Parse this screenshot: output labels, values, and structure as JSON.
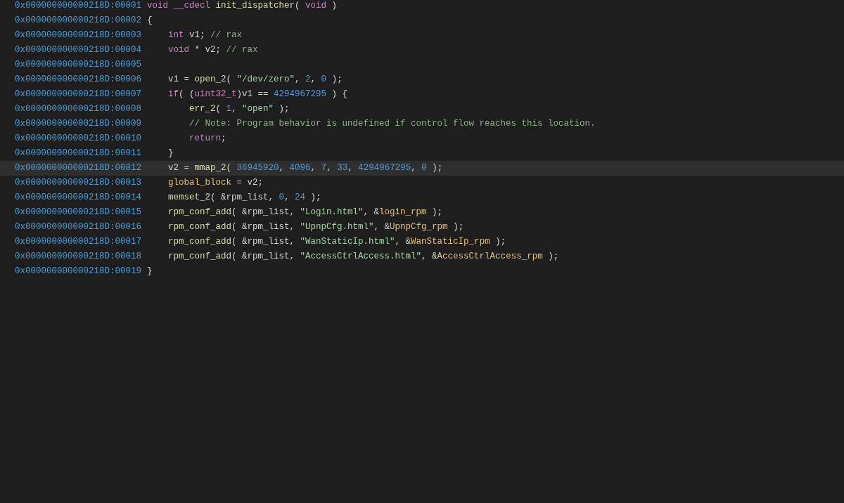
{
  "lines": [
    {
      "address": "0x000000000000218D:00001",
      "selected": false,
      "code": [
        {
          "kind": "kw",
          "text": "void"
        },
        {
          "kind": "kw",
          "text": " __cdecl"
        },
        {
          "kind": "fn",
          "text": " init_dispatcher"
        },
        {
          "kind": "tx",
          "text": "( "
        },
        {
          "kind": "kw",
          "text": "void"
        },
        {
          "kind": "tx",
          "text": " )"
        }
      ]
    },
    {
      "address": "0x000000000000218D:00002",
      "selected": false,
      "code": [
        {
          "kind": "tx",
          "text": "{"
        }
      ]
    },
    {
      "address": "0x000000000000218D:00003",
      "selected": false,
      "code": [
        {
          "kind": "kw",
          "text": "    int"
        },
        {
          "kind": "tx",
          "text": " v1; "
        },
        {
          "kind": "cm",
          "text": "// rax"
        }
      ]
    },
    {
      "address": "0x000000000000218D:00004",
      "selected": false,
      "code": [
        {
          "kind": "kw",
          "text": "    void"
        },
        {
          "kind": "tx",
          "text": " * v2; "
        },
        {
          "kind": "cm",
          "text": "// rax"
        }
      ]
    },
    {
      "address": "0x000000000000218D:00005",
      "selected": false
    },
    {
      "address": "0x000000000000218D:00006",
      "selected": false,
      "code": [
        {
          "kind": "tx",
          "text": "    v1 = "
        },
        {
          "kind": "fn",
          "text": "open_2"
        },
        {
          "kind": "tx",
          "text": "( "
        },
        {
          "kind": "str",
          "text": "\"/dev/zero\""
        },
        {
          "kind": "tx",
          "text": ", "
        },
        {
          "kind": "num",
          "text": "2"
        },
        {
          "kind": "tx",
          "text": ", "
        },
        {
          "kind": "num",
          "text": "0"
        },
        {
          "kind": "tx",
          "text": " );"
        }
      ]
    },
    {
      "address": "0x000000000000218D:00007",
      "selected": false,
      "code": [
        {
          "kind": "kw",
          "text": "    if"
        },
        {
          "kind": "tx",
          "text": "( ("
        },
        {
          "kind": "kw",
          "text": "uint32_t"
        },
        {
          "kind": "tx",
          "text": ")v1 == "
        },
        {
          "kind": "num",
          "text": "4294967295"
        },
        {
          "kind": "tx",
          "text": " ) {"
        }
      ]
    },
    {
      "address": "0x000000000000218D:00008",
      "selected": false,
      "code": [
        {
          "kind": "fn",
          "text": "        err_2"
        },
        {
          "kind": "tx",
          "text": "( "
        },
        {
          "kind": "num",
          "text": "1"
        },
        {
          "kind": "tx",
          "text": ", "
        },
        {
          "kind": "str",
          "text": "\"open\""
        },
        {
          "kind": "tx",
          "text": " );"
        }
      ]
    },
    {
      "address": "0x000000000000218D:00009",
      "selected": false,
      "code": [
        {
          "kind": "cm",
          "text": "        // Note: Program behavior is undefined if control flow reaches this location."
        }
      ]
    },
    {
      "address": "0x000000000000218D:00010",
      "selected": false,
      "code": [
        {
          "kind": "kw",
          "text": "        return"
        },
        {
          "kind": "tx",
          "text": ";"
        }
      ]
    },
    {
      "address": "0x000000000000218D:00011",
      "selected": false,
      "code": [
        {
          "kind": "tx",
          "text": "    }"
        }
      ]
    },
    {
      "address": "0x000000000000218D:00012",
      "selected": true,
      "code": [
        {
          "kind": "tx",
          "text": "    v2 = "
        },
        {
          "kind": "fn",
          "text": "mmap_2"
        },
        {
          "kind": "tx",
          "text": "( "
        },
        {
          "kind": "num",
          "text": "36945920"
        },
        {
          "kind": "tx",
          "text": ", "
        },
        {
          "kind": "num",
          "text": "4096"
        },
        {
          "kind": "tx",
          "text": ", "
        },
        {
          "kind": "num",
          "text": "7"
        },
        {
          "kind": "tx",
          "text": ", "
        },
        {
          "kind": "num",
          "text": "33"
        },
        {
          "kind": "tx",
          "text": ", "
        },
        {
          "kind": "num",
          "text": "4294967295"
        },
        {
          "kind": "tx",
          "text": ", "
        },
        {
          "kind": "num",
          "text": "0"
        },
        {
          "kind": "tx",
          "text": " );"
        }
      ]
    },
    {
      "address": "0x000000000000218D:00013",
      "selected": false,
      "code": [
        {
          "kind": "gl",
          "text": "    global_block"
        },
        {
          "kind": "tx",
          "text": " = v2;"
        }
      ]
    },
    {
      "address": "0x000000000000218D:00014",
      "selected": false,
      "code": [
        {
          "kind": "fn",
          "text": "    memset_2"
        },
        {
          "kind": "tx",
          "text": "( &rpm_list, "
        },
        {
          "kind": "num",
          "text": "0"
        },
        {
          "kind": "tx",
          "text": ", "
        },
        {
          "kind": "num",
          "text": "24"
        },
        {
          "kind": "tx",
          "text": " );"
        }
      ]
    },
    {
      "address": "0x000000000000218D:00015",
      "selected": false,
      "code": [
        {
          "kind": "fn",
          "text": "    rpm_conf_add"
        },
        {
          "kind": "tx",
          "text": "( &rpm_list, "
        },
        {
          "kind": "str",
          "text": "\"Login.html\""
        },
        {
          "kind": "tx",
          "text": ", &"
        },
        {
          "kind": "gl",
          "text": "login_rpm"
        },
        {
          "kind": "tx",
          "text": " );"
        }
      ]
    },
    {
      "address": "0x000000000000218D:00016",
      "selected": false,
      "code": [
        {
          "kind": "fn",
          "text": "    rpm_conf_add"
        },
        {
          "kind": "tx",
          "text": "( &rpm_list, "
        },
        {
          "kind": "str",
          "text": "\"UpnpCfg.html\""
        },
        {
          "kind": "tx",
          "text": ", &"
        },
        {
          "kind": "gl",
          "text": "UpnpCfg_rpm"
        },
        {
          "kind": "tx",
          "text": " );"
        }
      ]
    },
    {
      "address": "0x000000000000218D:00017",
      "selected": false,
      "code": [
        {
          "kind": "fn",
          "text": "    rpm_conf_add"
        },
        {
          "kind": "tx",
          "text": "( &rpm_list, "
        },
        {
          "kind": "str",
          "text": "\"WanStaticIp.html\""
        },
        {
          "kind": "tx",
          "text": ", &"
        },
        {
          "kind": "gl",
          "text": "WanStaticIp_rpm"
        },
        {
          "kind": "tx",
          "text": " );"
        }
      ]
    },
    {
      "address": "0x000000000000218D:00018",
      "selected": false,
      "code": [
        {
          "kind": "fn",
          "text": "    rpm_conf_add"
        },
        {
          "kind": "tx",
          "text": "( &rpm_list, "
        },
        {
          "kind": "str",
          "text": "\"AccessCtrlAccess.html\""
        },
        {
          "kind": "tx",
          "text": ", &"
        },
        {
          "kind": "gl",
          "text": "AccessCtrlAccess_rpm"
        },
        {
          "kind": "tx",
          "text": " );"
        }
      ]
    },
    {
      "address": "0x000000000000218D:00019",
      "selected": false,
      "code": [
        {
          "kind": "tx",
          "text": "}"
        }
      ]
    }
  ]
}
